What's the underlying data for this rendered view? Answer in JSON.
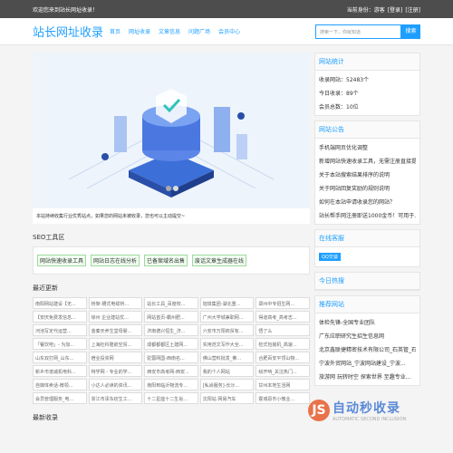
{
  "topbar": {
    "welcome": "欢迎您来到站长网址收录！",
    "identity": "当前身份：游客",
    "login": "[登录]",
    "register": "[注册]"
  },
  "header": {
    "logo": "站长网址收录",
    "nav": [
      "首页",
      "网址收录",
      "文章信息",
      "问题广场",
      "会员中心"
    ],
    "search_placeholder": "搜索一下，你就知道",
    "search_button": "搜索"
  },
  "banner": {
    "note": "本站持续收集行业优秀站点，如果您的网站未被收录，您也可以主动提交~"
  },
  "seo": {
    "title": "SEO工具区",
    "links": [
      "网站快速收录工具",
      "网站日志在线分析",
      "已备案域名出售",
      "废话文章生成器在线"
    ]
  },
  "recent": {
    "title": "最近更新",
    "items": [
      "南阳网站建设【无...",
      "桥架-槽式电缆桥...",
      "站长工具_百度权...",
      "旭铁集团-湖北重...",
      "郑州中专招生网...",
      "【安庆免费发信息...",
      "徐州 企业建站优...",
      "网站首页-霸州肥...",
      "广州大学城兼职网...",
      "得道高考_高考志...",
      "河池写定代运营...",
      "金秦天养生堂母婴...",
      "济南德兴恒生_济...",
      "六安市万阳商贸有...",
      "悟了么",
      "「餐饮吧」- 为加...",
      "上海杜科隆航空贸...",
      "成都都都区土建网...",
      "实用范文写作大全...",
      "检式包装机_高速...",
      "山东双打网_山东...",
      "宿业投资网",
      "驼蓉网国-西南名...",
      "佛山营料批发_佛...",
      "合肥百安平顶山物...",
      "新乡市谱诚机电科...",
      "特学网 - 专业的学...",
      "西安市高考网-西安...",
      "我的个人网站",
      "绘开呐_关注热门...",
      "自媒体卖话-微领...",
      "小达人必读的资讯...",
      "南阳到临沂物流专...",
      "[私尚服务]-长沙...",
      "甘州本地生活网",
      "会员管理服务_电...",
      "浙江市泽东纺生工...",
      "十二星座十二生肖...",
      "沈阳站 网易汽车",
      "霍城县市小微业..."
    ]
  },
  "latest_label": "最新收录",
  "stats": {
    "title": "网站统计",
    "rows": [
      "收录网站：52483个",
      "今日收录：89个",
      "会员总数：10位"
    ]
  },
  "notice": {
    "title": "网站公告",
    "items": [
      "手机端网页优化调整",
      "新增网站快速收录工具，无需注册直接提...",
      "关于本站搜索结果排序的说明",
      "关于网站回复奖励的规则说明",
      "如何在本站申请收录您的网站？",
      "站长帮手网注册即送1000金币！可用于..."
    ]
  },
  "service": {
    "title": "在线客服",
    "qq": "QQ交谈"
  },
  "hot": {
    "title": "今日热搜"
  },
  "recommend": {
    "title": "推荐网站",
    "items": [
      "体检先锋-全国专业团队",
      "广东应职研究生招生信息网",
      "北京鑫联捷精密技术有限公司_石英管_石...",
      "宁波外贸网站_宁波网站建设_宁波...",
      "旅游网 玩转时空 探索世界 至趣专业..."
    ]
  },
  "watermark": {
    "circle": "JS",
    "text": "自动秒收录",
    "sub": "AUTOMATIC SECOND INCLUSION"
  },
  "colors": {
    "accent": "#1e9fff",
    "topbar": "#4d4d4d"
  }
}
